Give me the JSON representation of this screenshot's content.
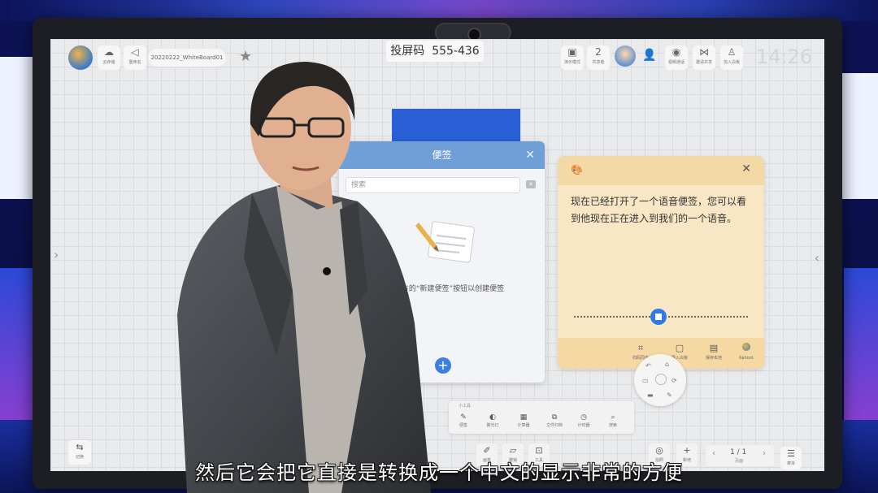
{
  "topbar": {
    "cloud_label": "云存储",
    "projection_label": "重命名",
    "document_name": "20220222_WhiteBoard01",
    "cast_code_label": "投屏码",
    "cast_code": "555-436",
    "demo_label": "演示模式",
    "share_count": "2",
    "share_label": "共享者",
    "video_call_label": "视频通话",
    "invite_label": "邀请共享",
    "join_label": "加入白板",
    "clock": "14:26"
  },
  "notes_panel": {
    "title": "便签",
    "search_placeholder": "搜索",
    "empty_hint": "点击下方的“新建便签”按钮以创建便签"
  },
  "voice_note": {
    "text": "现在已经打开了一个语音便签，您可以看到他现在正在进入到我们的一个语音。",
    "footer": [
      {
        "icon": "scan-icon",
        "label": "扫码同步"
      },
      {
        "icon": "note-icon",
        "label": "导入白板"
      },
      {
        "icon": "save-icon",
        "label": "保存本地"
      },
      {
        "icon": "kahoot-icon",
        "label": "Kahoot"
      }
    ]
  },
  "small_tools": {
    "title": "小工具",
    "items": [
      {
        "icon": "sticky-note-icon",
        "label": "便签"
      },
      {
        "icon": "spotlight-icon",
        "label": "聚光灯"
      },
      {
        "icon": "calculator-icon",
        "label": "计算器"
      },
      {
        "icon": "file-icon",
        "label": "文件归档"
      },
      {
        "icon": "timer-icon",
        "label": "计时器"
      },
      {
        "icon": "search-icon",
        "label": "搜索"
      }
    ]
  },
  "bottom_bar": {
    "switch_label": "切换",
    "pen_label": "画笔",
    "undo_label": "撤销",
    "toolbox_label": "工具",
    "camera_label": "拍照",
    "add_label": "新增",
    "page": "1 / 1",
    "page_label": "页面",
    "menu_label": "菜单"
  },
  "subtitle": "然后它会把它直接是转换成一个中文的显示非常的方便",
  "colors": {
    "accent_blue": "#2a5fd7",
    "notes_header": "#6f9fd6",
    "voice_card": "#f8e6c4"
  }
}
